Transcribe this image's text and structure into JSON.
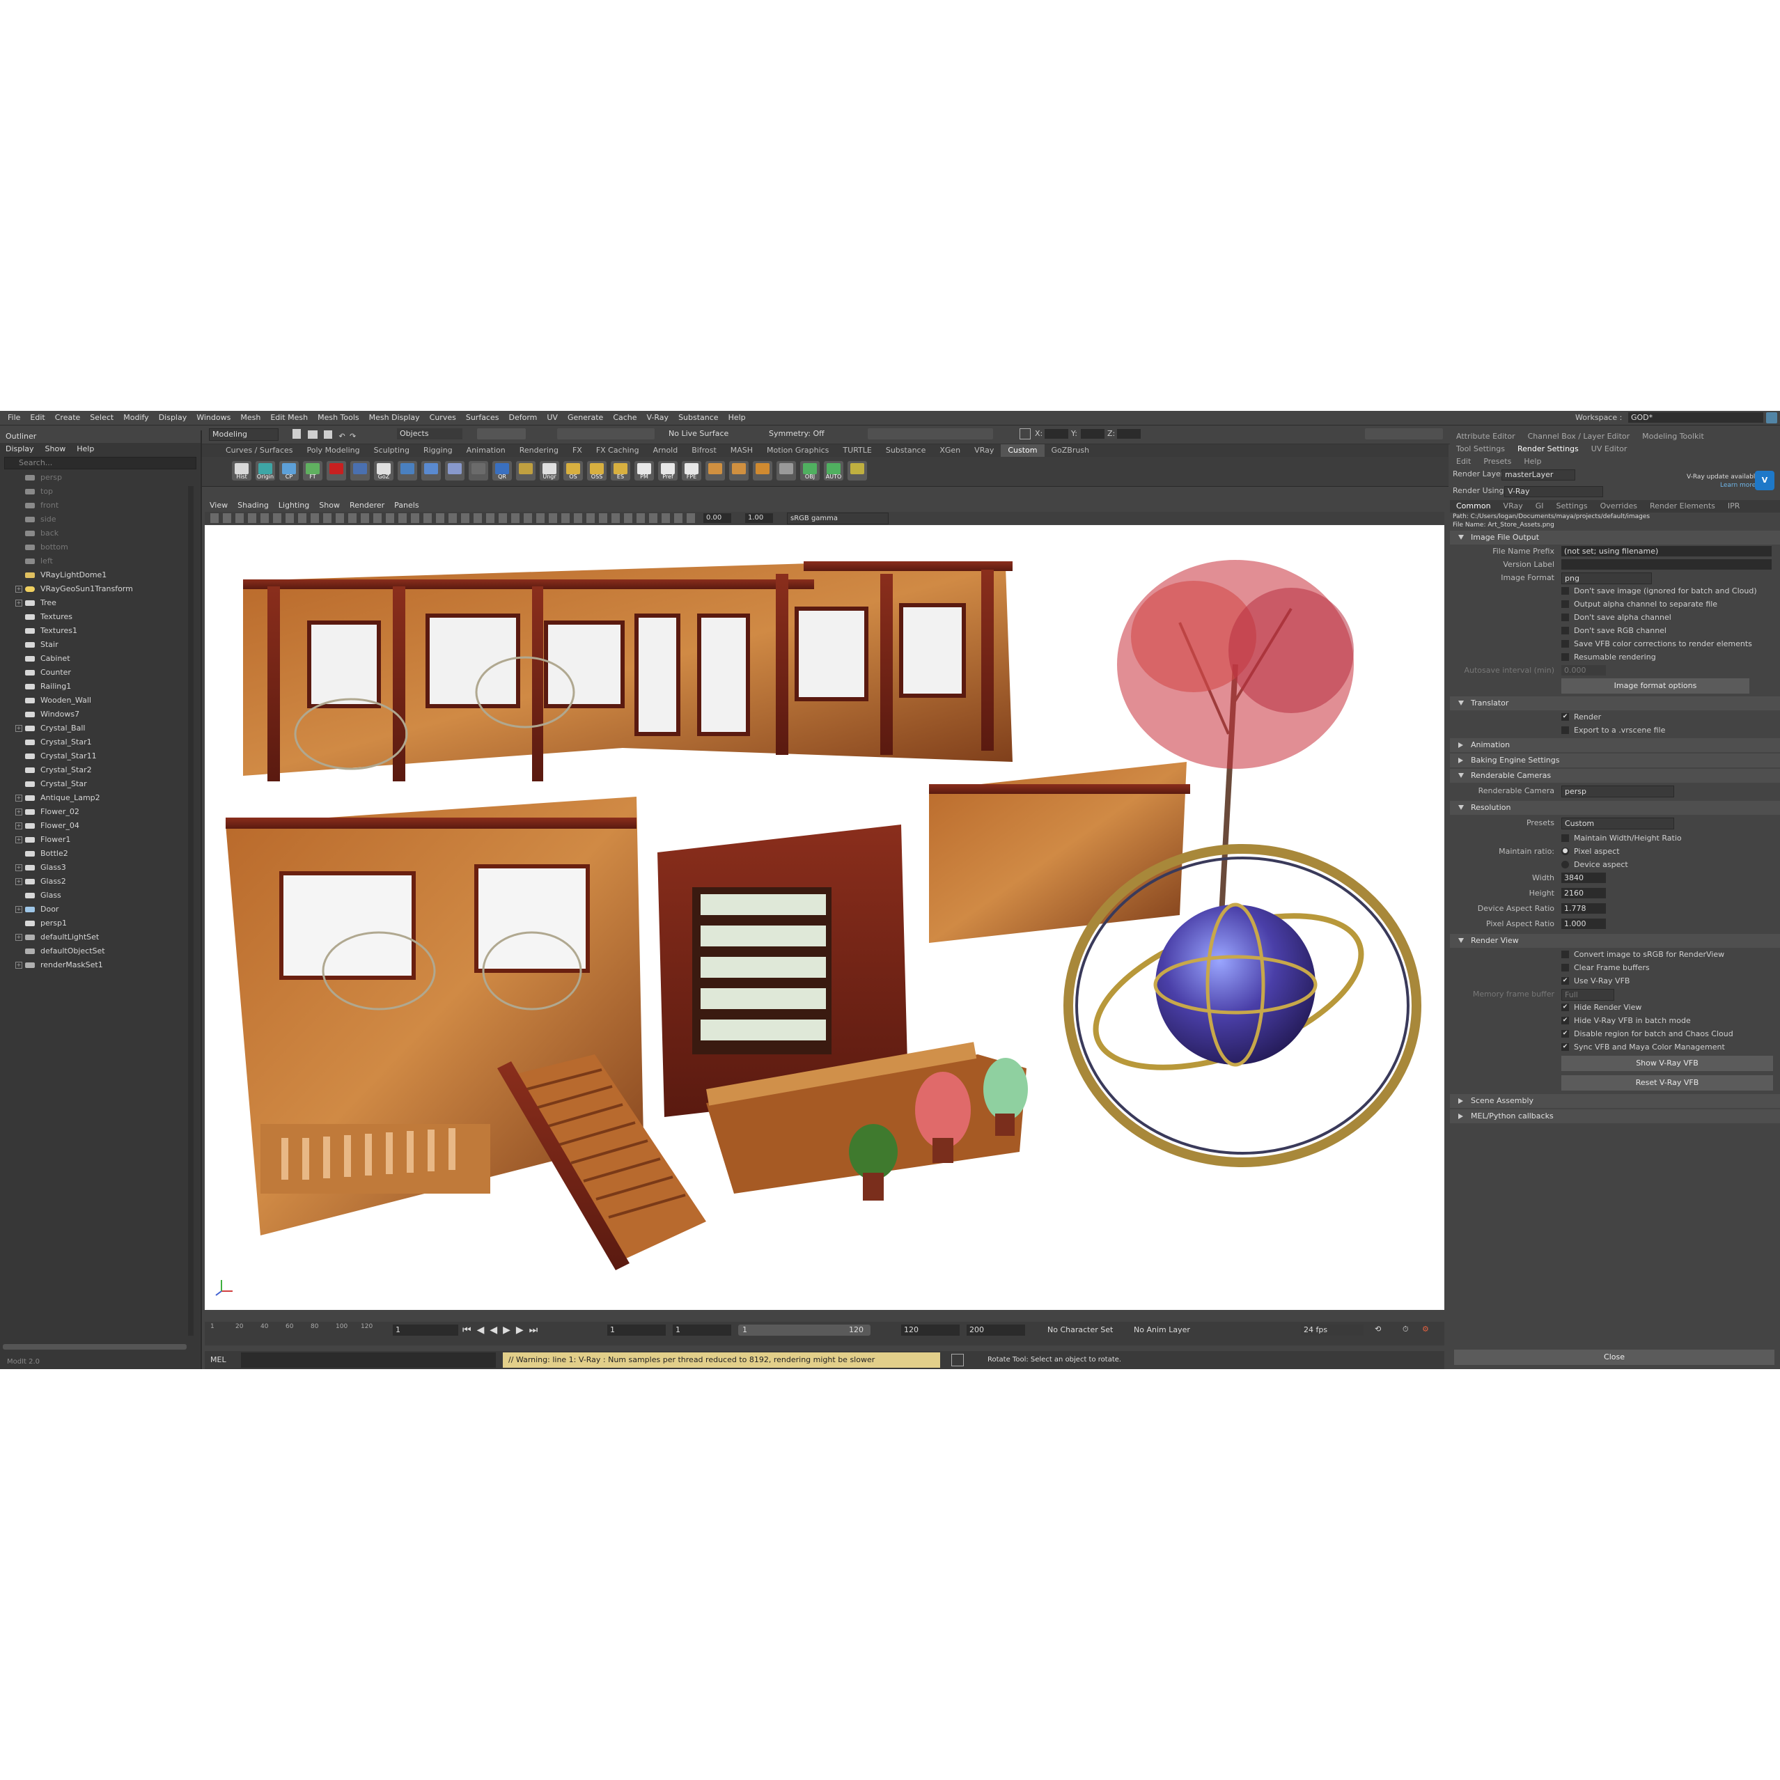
{
  "menu": [
    "File",
    "Edit",
    "Create",
    "Select",
    "Modify",
    "Display",
    "Windows",
    "Mesh",
    "Edit Mesh",
    "Mesh Tools",
    "Mesh Display",
    "Curves",
    "Surfaces",
    "Deform",
    "UV",
    "Generate",
    "Cache",
    "V-Ray",
    "Substance",
    "Help"
  ],
  "workspace": {
    "label": "Workspace :",
    "value": "GOD*"
  },
  "status": {
    "mode": "Modeling",
    "objects": "Objects",
    "live_surface": "No Live Surface",
    "symmetry": "Symmetry: Off",
    "x": "X:",
    "y": "Y:",
    "z": "Z:"
  },
  "shelf_tabs": [
    "Curves / Surfaces",
    "Poly Modeling",
    "Sculpting",
    "Rigging",
    "Animation",
    "Rendering",
    "FX",
    "FX Caching",
    "Arnold",
    "Bifrost",
    "MASH",
    "Motion Graphics",
    "TURTLE",
    "Substance",
    "XGen",
    "VRay",
    "Custom",
    "GoZBrush"
  ],
  "shelf_active": "Custom",
  "shelf_buttons": [
    {
      "label": "Hist",
      "color": "#d9d9d9"
    },
    {
      "label": "Origin",
      "color": "#3ea6a6"
    },
    {
      "label": "CP",
      "color": "#5da0d8"
    },
    {
      "label": "FT",
      "color": "#60b060"
    },
    {
      "label": "",
      "color": "#c82020"
    },
    {
      "label": "",
      "color": "#4a70b0"
    },
    {
      "label": "GoZ",
      "color": "#e0e0e0"
    },
    {
      "label": "",
      "color": "#4a80c0"
    },
    {
      "label": "",
      "color": "#5a8ad0"
    },
    {
      "label": "",
      "color": "#8899cc"
    },
    {
      "label": "",
      "color": "#6b6b6b"
    },
    {
      "label": "QR",
      "color": "#3a70c0"
    },
    {
      "label": "",
      "color": "#c0a040"
    },
    {
      "label": "Ungr",
      "color": "#e0e0e0"
    },
    {
      "label": "OS",
      "color": "#d8b040"
    },
    {
      "label": "OSS",
      "color": "#d8b040"
    },
    {
      "label": "ES",
      "color": "#d8b040"
    },
    {
      "label": "PM",
      "color": "#e8e8e8"
    },
    {
      "label": "Pref",
      "color": "#e8e8e8"
    },
    {
      "label": "FPE",
      "color": "#e8e8e8"
    },
    {
      "label": "",
      "color": "#d09040"
    },
    {
      "label": "",
      "color": "#d09040"
    },
    {
      "label": "",
      "color": "#d08a30"
    },
    {
      "label": "",
      "color": "#9a9a9a"
    },
    {
      "label": "OBJ EXPORT",
      "color": "#50b060"
    },
    {
      "label": "AUTO RIG",
      "color": "#50b060"
    },
    {
      "label": "",
      "color": "#c0b040"
    }
  ],
  "outliner": {
    "title": "Outliner",
    "menu": [
      "Display",
      "Show",
      "Help"
    ],
    "search_placeholder": "Search...",
    "items": [
      {
        "name": "persp",
        "dim": true,
        "exp": false,
        "icon": "camera-icon"
      },
      {
        "name": "top",
        "dim": true,
        "exp": false,
        "icon": "camera-icon"
      },
      {
        "name": "front",
        "dim": true,
        "exp": false,
        "icon": "camera-icon"
      },
      {
        "name": "side",
        "dim": true,
        "exp": false,
        "icon": "camera-icon"
      },
      {
        "name": "back",
        "dim": true,
        "exp": false,
        "icon": "camera-icon"
      },
      {
        "name": "bottom",
        "dim": true,
        "exp": false,
        "icon": "camera-icon"
      },
      {
        "name": "left",
        "dim": true,
        "exp": false,
        "icon": "camera-icon"
      },
      {
        "name": "VRayLightDome1",
        "dim": false,
        "exp": false,
        "icon": "dome-light-icon"
      },
      {
        "name": "VRayGeoSun1Transform",
        "dim": false,
        "exp": true,
        "icon": "sun-icon"
      },
      {
        "name": "Tree",
        "dim": false,
        "exp": true,
        "icon": "group-icon"
      },
      {
        "name": "Textures",
        "dim": false,
        "exp": false,
        "icon": "group-icon"
      },
      {
        "name": "Textures1",
        "dim": false,
        "exp": false,
        "icon": "group-icon"
      },
      {
        "name": "Stair",
        "dim": false,
        "exp": false,
        "icon": "group-icon"
      },
      {
        "name": "Cabinet",
        "dim": false,
        "exp": false,
        "icon": "group-icon"
      },
      {
        "name": "Counter",
        "dim": false,
        "exp": false,
        "icon": "group-icon"
      },
      {
        "name": "Railing1",
        "dim": false,
        "exp": false,
        "icon": "group-icon"
      },
      {
        "name": "Wooden_Wall",
        "dim": false,
        "exp": false,
        "icon": "group-icon"
      },
      {
        "name": "Windows7",
        "dim": false,
        "exp": false,
        "icon": "group-icon"
      },
      {
        "name": "Crystal_Ball",
        "dim": false,
        "exp": true,
        "icon": "group-icon"
      },
      {
        "name": "Crystal_Star1",
        "dim": false,
        "exp": false,
        "icon": "group-icon"
      },
      {
        "name": "Crystal_Star11",
        "dim": false,
        "exp": false,
        "icon": "group-icon"
      },
      {
        "name": "Crystal_Star2",
        "dim": false,
        "exp": false,
        "icon": "group-icon"
      },
      {
        "name": "Crystal_Star",
        "dim": false,
        "exp": false,
        "icon": "group-icon"
      },
      {
        "name": "Antique_Lamp2",
        "dim": false,
        "exp": true,
        "icon": "group-icon"
      },
      {
        "name": "Flower_02",
        "dim": false,
        "exp": true,
        "icon": "group-icon"
      },
      {
        "name": "Flower_04",
        "dim": false,
        "exp": true,
        "icon": "group-icon"
      },
      {
        "name": "Flower1",
        "dim": false,
        "exp": true,
        "icon": "group-icon"
      },
      {
        "name": "Bottle2",
        "dim": false,
        "exp": false,
        "icon": "group-icon"
      },
      {
        "name": "Glass3",
        "dim": false,
        "exp": true,
        "icon": "group-icon"
      },
      {
        "name": "Glass2",
        "dim": false,
        "exp": true,
        "icon": "group-icon"
      },
      {
        "name": "Glass",
        "dim": false,
        "exp": false,
        "icon": "group-icon"
      },
      {
        "name": "Door",
        "dim": false,
        "exp": true,
        "icon": "mesh-icon"
      },
      {
        "name": "persp1",
        "dim": false,
        "exp": false,
        "icon": "group-icon"
      },
      {
        "name": "defaultLightSet",
        "dim": false,
        "exp": true,
        "icon": "set-icon"
      },
      {
        "name": "defaultObjectSet",
        "dim": false,
        "exp": false,
        "icon": "set-icon"
      },
      {
        "name": "renderMaskSet1",
        "dim": false,
        "exp": true,
        "icon": "set-icon"
      }
    ],
    "footer": "ModIt 2.0"
  },
  "panel_menu": [
    "View",
    "Shading",
    "Lighting",
    "Show",
    "Renderer",
    "Panels"
  ],
  "viewport_toolbar": {
    "exposure": "0.00",
    "gamma": "1.00",
    "color_space": "sRGB gamma"
  },
  "timeline": {
    "ticks": [
      "1",
      "20",
      "40",
      "60",
      "80",
      "100",
      "120"
    ],
    "current": "1",
    "range_start": "1",
    "range_start2": "1",
    "slider_start": "1",
    "slider_end": "120",
    "end": "120",
    "end2": "200",
    "character_set": "No Character Set",
    "anim_layer": "No Anim Layer",
    "fps": "24 fps"
  },
  "command": {
    "lang": "MEL",
    "warning": "// Warning: line 1: V-Ray : Num samples per thread reduced to 8192, rendering might be slower",
    "help": "Rotate Tool: Select an object to rotate."
  },
  "right": {
    "top_tabs": [
      "Attribute Editor",
      "Channel Box / Layer Editor",
      "Modeling Toolkit"
    ],
    "tabs2": [
      "Tool Settings",
      "Render Settings",
      "UV Editor"
    ],
    "tabs2_active": "Render Settings",
    "menu": [
      "Edit",
      "Presets",
      "Help"
    ],
    "render_layer_label": "Render Layer",
    "render_layer": "masterLayer",
    "render_using_label": "Render Using",
    "render_using": "V-Ray",
    "update_text": "V-Ray update available",
    "learn_more": "Learn more",
    "rs_tabs": [
      "Common",
      "VRay",
      "GI",
      "Settings",
      "Overrides",
      "Render Elements",
      "IPR"
    ],
    "rs_active": "Common",
    "path": "Path: C:/Users/logan/Documents/maya/projects/default/images",
    "file_name": "File Name: Art_Store_Assets.png",
    "sections": {
      "image_file_output": "Image File Output",
      "translator": "Translator",
      "animation": "Animation",
      "baking": "Baking Engine Settings",
      "renderable_cameras": "Renderable Cameras",
      "resolution": "Resolution",
      "render_view": "Render View",
      "scene_assembly": "Scene Assembly",
      "mel_callbacks": "MEL/Python callbacks"
    },
    "ifo": {
      "prefix_label": "File Name Prefix",
      "prefix": "(not set; using filename)",
      "version_label": "Version Label",
      "version": "",
      "format_label": "Image Format",
      "format": "png",
      "checks": [
        {
          "label": "Don't save image (ignored for batch and Cloud)",
          "on": false
        },
        {
          "label": "Output alpha channel to separate file",
          "on": false
        },
        {
          "label": "Don't save alpha channel",
          "on": false
        },
        {
          "label": "Don't save RGB channel",
          "on": false
        },
        {
          "label": "Save VFB color corrections to render elements",
          "on": false
        },
        {
          "label": "Resumable rendering",
          "on": false
        }
      ],
      "autosave_label": "Autosave interval (min)",
      "autosave": "0.000",
      "format_options": "Image format options"
    },
    "translator": {
      "render": "Render",
      "export": "Export to a .vrscene file"
    },
    "cameras": {
      "label": "Renderable Camera",
      "value": "persp"
    },
    "resolution": {
      "presets_label": "Presets",
      "presets": "Custom",
      "maintain_wh": "Maintain Width/Height Ratio",
      "maintain_ratio_label": "Maintain ratio:",
      "pixel_aspect": "Pixel aspect",
      "device_aspect": "Device aspect",
      "width_label": "Width",
      "width": "3840",
      "height_label": "Height",
      "height": "2160",
      "dar_label": "Device Aspect Ratio",
      "dar": "1.778",
      "par_label": "Pixel Aspect Ratio",
      "par": "1.000"
    },
    "render_view": {
      "checks": [
        {
          "label": "Convert image to sRGB for RenderView",
          "on": false
        },
        {
          "label": "Clear Frame buffers",
          "on": false
        },
        {
          "label": "Use V-Ray VFB",
          "on": true
        }
      ],
      "memfb_label": "Memory frame buffer",
      "memfb": "Full",
      "checks2": [
        {
          "label": "Hide Render View",
          "on": true
        },
        {
          "label": "Hide V-Ray VFB in batch mode",
          "on": true
        },
        {
          "label": "Disable region for batch and Chaos Cloud",
          "on": true
        },
        {
          "label": "Sync VFB and Maya Color Management",
          "on": true
        }
      ],
      "show_vfb": "Show V-Ray VFB",
      "reset_vfb": "Reset V-Ray VFB"
    },
    "close": "Close"
  },
  "colors": {
    "accent": "#5285a6",
    "wood": "#8a4a20",
    "crystal": "#4c3a9a",
    "tree": "#c8323c"
  }
}
